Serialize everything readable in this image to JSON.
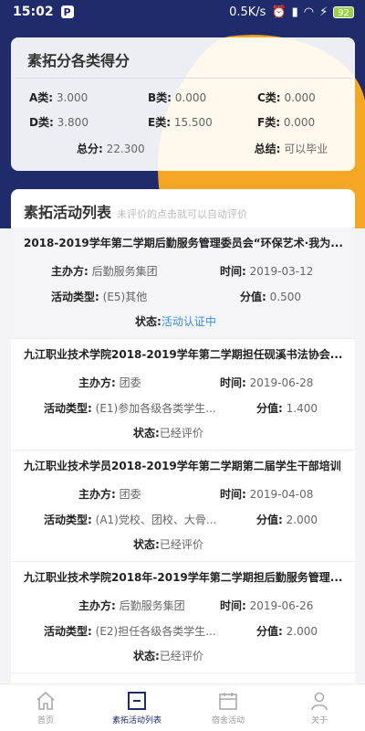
{
  "status_bar": {
    "time": "15:02",
    "app_icon": "P",
    "speed": "0.5K/s",
    "battery": "92"
  },
  "scores": {
    "title": "素拓分各类得分",
    "items": [
      {
        "label": "A类:",
        "value": "3.000"
      },
      {
        "label": "B类:",
        "value": "0.000"
      },
      {
        "label": "C类:",
        "value": "0.000"
      },
      {
        "label": "D类:",
        "value": "3.800"
      },
      {
        "label": "E类:",
        "value": "15.500"
      },
      {
        "label": "F类:",
        "value": "0.000"
      }
    ],
    "total_label": "总分:",
    "total_value": "22.300",
    "conclusion_label": "总结:",
    "conclusion_value": "可以毕业"
  },
  "activities": {
    "title": "素拓活动列表",
    "hint": "未评价的点击就可以自动评价",
    "organizer_label": "主办方:",
    "time_label": "时间:",
    "type_label": "活动类型:",
    "points_label": "分值:",
    "status_label": "状态:",
    "items": [
      {
        "title": "2018-2019学年第二学期后勤服务管理委员会“环保艺术·我为...",
        "organizer": "后勤服务集团",
        "time": "2019-03-12",
        "type": "(E5)其他",
        "points": "0.500",
        "status": "活动认证中"
      },
      {
        "title": "九江职业技术学院2018-2019学年第二学期担任砚溪书法协会...",
        "organizer": "团委",
        "time": "2019-06-28",
        "type": "(E1)参加各级各类学生...",
        "points": "1.400",
        "status": "已经评价"
      },
      {
        "title": "九江职业技术学员2018-2019学年第二学期第二届学生干部培训",
        "organizer": "团委",
        "time": "2019-04-08",
        "type": "(A1)党校、团校、大骨...",
        "points": "2.000",
        "status": "已经评价"
      },
      {
        "title": "九江职业技术学院2018年-2019学年第二学期担后勤服务管理...",
        "organizer": "后勤服务集团",
        "time": "2019-06-26",
        "type": "(E2)担任各级各类学生...",
        "points": "2.000",
        "status": "已经评价"
      }
    ]
  },
  "tabs": [
    {
      "label": "首页",
      "icon": "home-icon"
    },
    {
      "label": "素拓活动列表",
      "icon": "list-icon"
    },
    {
      "label": "宿舍活动",
      "icon": "calendar-icon"
    },
    {
      "label": "关于",
      "icon": "person-icon"
    }
  ],
  "colors": {
    "navy": "#1f2b6b",
    "orange": "#f5a623",
    "link": "#3a8ee6"
  }
}
